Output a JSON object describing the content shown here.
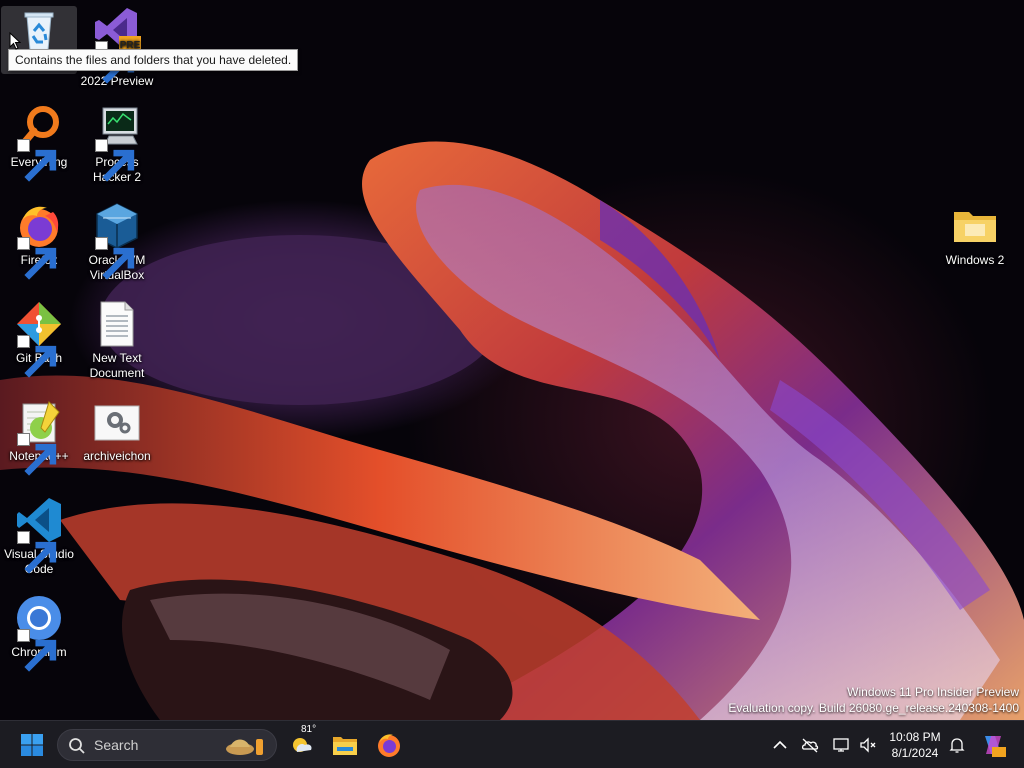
{
  "desktop": {
    "icons": [
      {
        "id": "recycle-bin",
        "label": "Recycle Bin"
      },
      {
        "id": "visual-studio",
        "label": "2022 Preview"
      },
      {
        "id": "everything",
        "label": "Everything"
      },
      {
        "id": "process-hacker",
        "label": "Process Hacker 2"
      },
      {
        "id": "firefox",
        "label": "Firefox"
      },
      {
        "id": "virtualbox",
        "label": "Oracle VM VirtualBox"
      },
      {
        "id": "git-bash",
        "label": "Git Bash"
      },
      {
        "id": "new-text-document",
        "label": "New Text Document"
      },
      {
        "id": "notepadpp",
        "label": "Notepad++"
      },
      {
        "id": "archiveichon",
        "label": "archiveichon"
      },
      {
        "id": "vscode",
        "label": "Visual Studio Code"
      },
      {
        "id": "chromium",
        "label": "Chromium"
      },
      {
        "id": "windows-2-folder",
        "label": "Windows 2"
      }
    ],
    "tooltip": "Contains the files and folders that you have deleted.",
    "watermark": {
      "line1": "Windows 11 Pro Insider Preview",
      "line2": "Evaluation copy. Build 26080.ge_release.240308-1400"
    }
  },
  "taskbar": {
    "search_label": "Search",
    "weather_temp": "81°",
    "pinned": [
      "start-icon",
      "weather-icon",
      "file-explorer-icon",
      "firefox-icon"
    ],
    "tray": [
      "chevron-up-icon",
      "onedrive-offline-icon",
      "network-icon",
      "volume-muted-icon"
    ],
    "clock": {
      "time": "10:08 PM",
      "date": "8/1/2024"
    },
    "accent": "#0078d4"
  }
}
